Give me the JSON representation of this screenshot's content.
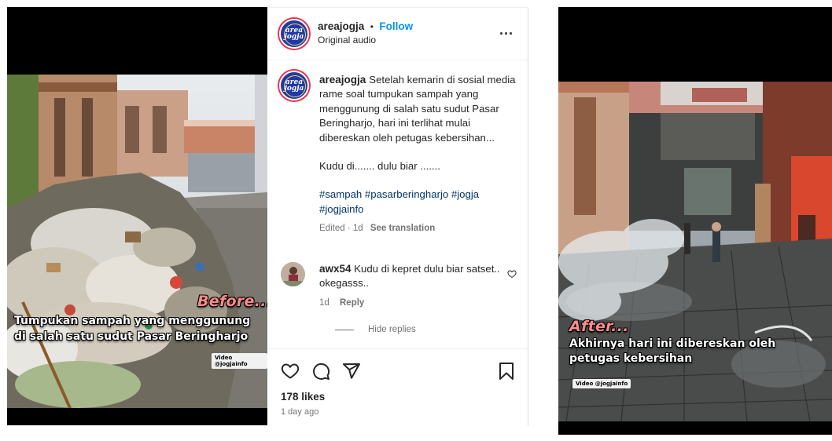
{
  "left_video": {
    "caption_title": "Before...",
    "caption_line1": "Tumpukan sampah yang menggunung",
    "caption_line2": "di salah satu sudut Pasar Beringharjo",
    "credit": "Video @jogjainfo"
  },
  "post": {
    "avatar_text": "area jogja",
    "username": "areajogja",
    "separator": "•",
    "follow_label": "Follow",
    "audio": "Original audio",
    "more_label": "...",
    "caption": "Setelah kemarin di sosial media rame soal tumpukan sampah yang menggunung di salah satu sudut Pasar Beringharjo, hari ini terlihat mulai dibereskan oleh petugas kebersihan...",
    "caption2": "Kudu di....... dulu biar .......",
    "hashtags": "#sampah #pasarberingharjo #jogja #jogjainfo",
    "edited": "Edited · 1d",
    "see_translation": "See translation",
    "comment": {
      "username": "awx54",
      "text": "Kudu di kepret dulu biar satset.. okegasss..",
      "time": "1d",
      "reply_label": "Reply"
    },
    "hide_replies": "Hide replies",
    "likes": "178 likes",
    "time_ago": "1 day ago",
    "icons": [
      "heart-icon",
      "comment-icon",
      "share-icon",
      "bookmark-icon"
    ]
  },
  "right_video": {
    "caption_title": "After...",
    "caption_line1": "Akhirnya hari ini dibereskan oleh",
    "caption_line2": "petugas kebersihan",
    "credit": "Video @jogjainfo"
  },
  "colors": {
    "follow": "#0095f6",
    "hashtag": "#00376b",
    "before_title": "#ff8a8a",
    "after_title": "#ff8a8a"
  }
}
